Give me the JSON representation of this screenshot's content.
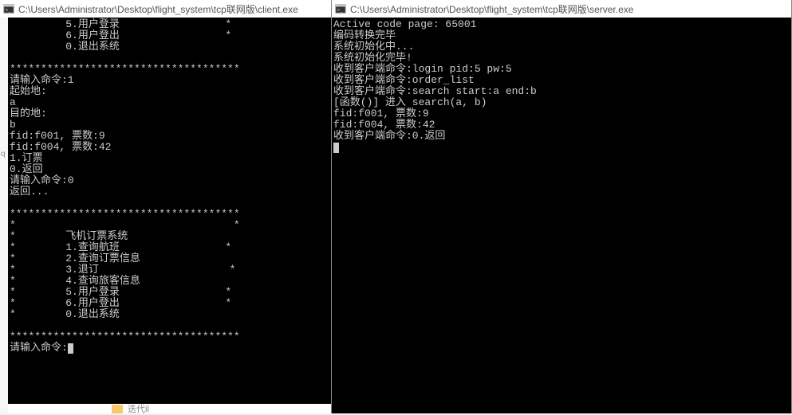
{
  "left": {
    "title": "C:\\Users\\Administrator\\Desktop\\flight_system\\tcp联网版\\client.exe",
    "lines": [
      "         5.用户登录                 *",
      "         6.用户登出                 *",
      "         0.退出系统",
      "",
      "*************************************",
      "请输入命令:1",
      "起始地:",
      "a",
      "目的地:",
      "b",
      "fid:f001, 票数:9",
      "fid:f004, 票数:42",
      "1.订票",
      "0.返回",
      "请输入命令:0",
      "返回...",
      "",
      "*************************************",
      "*                                   *",
      "*        飞机订票系统",
      "*        1.查询航班                 *",
      "*        2.查询订票信息",
      "*        3.退订                     *",
      "*        4.查询旅客信息",
      "*        5.用户登录                 *",
      "*        6.用户登出                 *",
      "*        0.退出系统",
      "",
      "*************************************",
      "请输入命令:"
    ],
    "bottom_folder": "迭代il"
  },
  "right": {
    "title": "C:\\Users\\Administrator\\Desktop\\flight_system\\tcp联网版\\server.exe",
    "lines": [
      "Active code page: 65001",
      "编码转换完毕",
      "系统初始化中...",
      "系统初始化完毕!",
      "收到客户端命令:login pid:5 pw:5",
      "收到客户端命令:order_list",
      "收到客户端命令:search start:a end:b",
      "[函数()] 进入 search(a, b)",
      "fid:f001, 票数:9",
      "fid:f004, 票数:42",
      "收到客户端命令:0.返回"
    ]
  }
}
